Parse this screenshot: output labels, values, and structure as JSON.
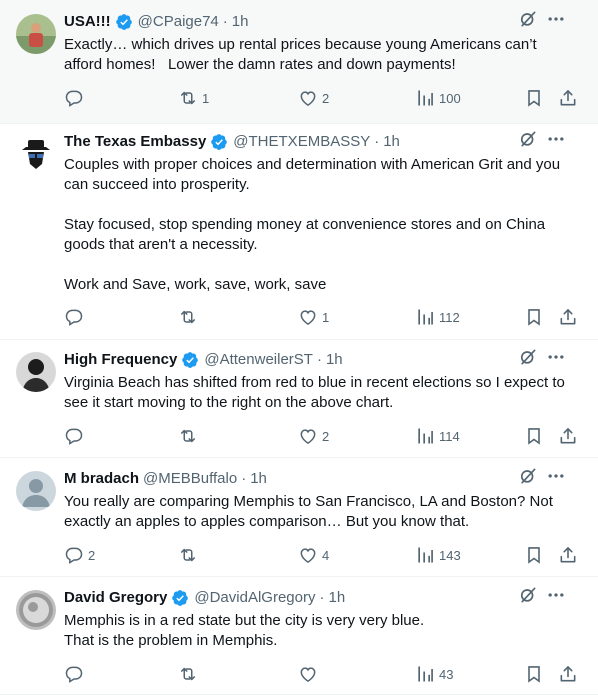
{
  "tweets": [
    {
      "name": "USA!!!",
      "verified": true,
      "handle": "@CPaige74",
      "time": "1h",
      "body": "Exactly… which drives up rental prices because young Americans can’t\nafford homes!   Lower the damn rates and down payments!",
      "replies": "",
      "reposts": "1",
      "likes": "2",
      "views": "100",
      "avatar_colors": [
        "#7d9b6a",
        "#c94f45"
      ]
    },
    {
      "name": "The Texas Embassy",
      "verified": true,
      "handle": "@THETXEMBASSY",
      "time": "1h",
      "body": "Couples with proper choices and determination with American Grit and you\ncan succeed into prosperity.\n\nStay focused, stop spending money at convenience stores and on China\ngoods that aren't a necessity.\n\nWork and Save, work, save, work, save",
      "replies": "",
      "reposts": "",
      "likes": "1",
      "views": "112",
      "avatar_colors": [
        "#1a1a1a",
        "#3b6fb6"
      ]
    },
    {
      "name": "High Frequency",
      "verified": true,
      "handle": "@AttenweilerST",
      "time": "1h",
      "body": "Virginia Beach has shifted from red to blue in recent elections so I expect to\nsee it start moving to the right on the above chart.",
      "replies": "",
      "reposts": "",
      "likes": "2",
      "views": "114",
      "avatar_colors": [
        "#2b2b2b",
        "#d8d8d8"
      ]
    },
    {
      "name": "M bradach",
      "verified": false,
      "handle": "@MEBBuffalo",
      "time": "1h",
      "body": "You really are comparing Memphis to San Francisco, LA and Boston? Not\nexactly an apples to apples comparison… But you know that.",
      "replies": "2",
      "reposts": "",
      "likes": "4",
      "views": "143",
      "avatar_colors": [
        "#ccd6dd",
        "#8899a6"
      ]
    },
    {
      "name": "David Gregory",
      "verified": true,
      "handle": "@DavidAlGregory",
      "time": "1h",
      "body": "Memphis is in a red state but the city is very very blue.\nThat is the problem in Memphis.",
      "replies": "",
      "reposts": "",
      "likes": "",
      "views": "43",
      "avatar_colors": [
        "#9a9a9a",
        "#d9d9d9"
      ]
    }
  ],
  "colors": {
    "verified": "#1d9bf0",
    "text": "#0f1419",
    "secondary": "#536471",
    "highlight_bg": "#f7f9f9",
    "divider": "#eff3f4"
  },
  "icons": {
    "head": [
      "grok-icon",
      "more-icon"
    ],
    "actions": [
      "reply-icon",
      "repost-icon",
      "like-icon",
      "views-icon",
      "bookmark-icon",
      "share-icon"
    ]
  }
}
